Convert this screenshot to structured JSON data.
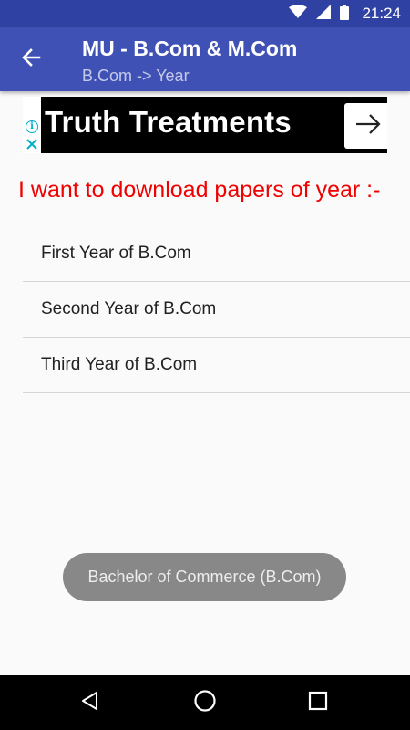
{
  "status_bar": {
    "time": "21:24",
    "color": "#2f42a3"
  },
  "app_bar": {
    "title": "MU - B.Com & M.Com",
    "subtitle": "B.Com -> Year",
    "color": "#3f51b5",
    "back_icon": "arrow-left-icon"
  },
  "ad": {
    "title": "Truth Treatments",
    "info_glyph": "i",
    "icons": [
      "info-icon",
      "close-icon",
      "arrow-right-icon"
    ]
  },
  "prompt": {
    "text": "I want to download papers of year :-",
    "color": "#f00000"
  },
  "year_list": {
    "items": [
      {
        "label": "First Year of B.Com"
      },
      {
        "label": "Second Year of B.Com"
      },
      {
        "label": "Third Year of B.Com"
      }
    ]
  },
  "toast": {
    "text": "Bachelor of Commerce (B.Com)"
  },
  "nav_bar": {
    "icons": [
      "back-triangle-icon",
      "home-circle-icon",
      "recents-square-icon"
    ]
  }
}
